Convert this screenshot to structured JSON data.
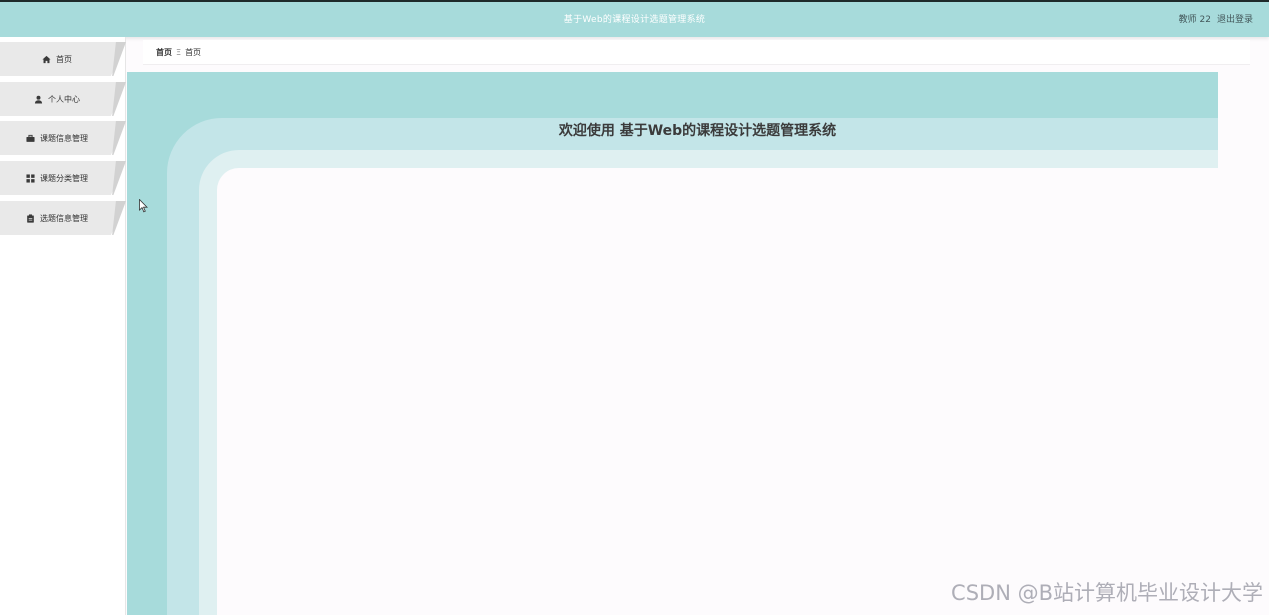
{
  "app": {
    "title": "基于Web的课程设计选题管理系统",
    "user": "教师 22",
    "logout_label": "退出登录"
  },
  "sidebar": {
    "items": [
      {
        "label": "首页",
        "icon": "home-icon"
      },
      {
        "label": "个人中心",
        "icon": "user-icon"
      },
      {
        "label": "课题信息管理",
        "icon": "briefcase-icon"
      },
      {
        "label": "课题分类管理",
        "icon": "grid-icon"
      },
      {
        "label": "选题信息管理",
        "icon": "clipboard-icon"
      }
    ]
  },
  "breadcrumb": {
    "home": "首页",
    "separator": "Ξ",
    "current": "首页"
  },
  "main": {
    "welcome": "欢迎使用 基于Web的课程设计选题管理系统"
  },
  "watermark": "CSDN @B站计算机毕业设计大学",
  "colors": {
    "topbar": "#a7dbdb",
    "band_light": "#c3e5e8",
    "band_lighter": "#dff0f1",
    "menu_bg": "#e9e9e9"
  }
}
